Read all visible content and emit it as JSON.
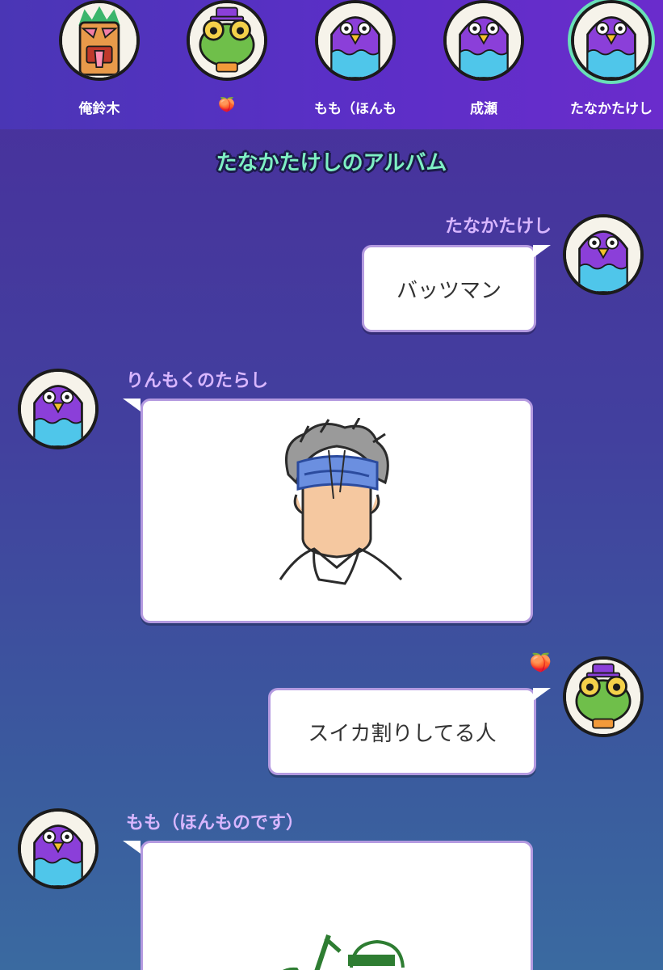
{
  "top_players": [
    {
      "name": "",
      "avatar": "pigeon-icon",
      "crown": true
    },
    {
      "name": "俺鈴木",
      "avatar": "tiki-mask-icon"
    },
    {
      "name": "🍑",
      "avatar": "frog-icon"
    },
    {
      "name": "もも（ほんも",
      "avatar": "pigeon-icon"
    },
    {
      "name": "成瀬",
      "avatar": "pigeon-icon"
    },
    {
      "name": "たなかたけし",
      "avatar": "pigeon-icon",
      "active": true
    }
  ],
  "album_title": "たなかたけしのアルバム",
  "messages": [
    {
      "author": "たなかたけし",
      "text": "バッツマン",
      "side": "right",
      "avatar": "pigeon-icon"
    },
    {
      "author": "りんもくのたらし",
      "drawing": "drawing-headband-man",
      "side": "left",
      "avatar": "pigeon-icon"
    },
    {
      "author": "🍑",
      "text": "スイカ割りしてる人",
      "side": "right",
      "avatar": "frog-icon"
    },
    {
      "author": "もも（ほんものです）",
      "drawing": "drawing-watermelon-split",
      "side": "left",
      "avatar": "pigeon-icon"
    }
  ],
  "colors": {
    "accent": "#7ef0c4",
    "name_text": "#d8b6ff",
    "bubble_border": "#b49ae0",
    "active_ring": "#69e0b8"
  }
}
